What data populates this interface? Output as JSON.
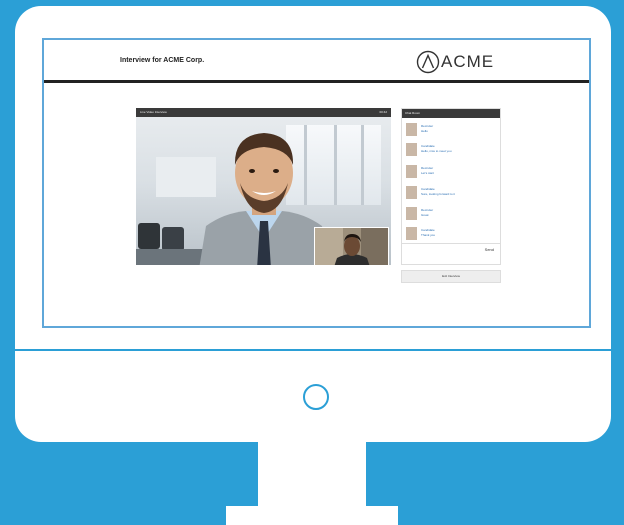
{
  "app": {
    "title": "Interview for ACME Corp.",
    "logo_text": "ACME"
  },
  "video": {
    "header_left": "Live Video Interview",
    "header_right": "00:42",
    "participants": [
      "candidate",
      "interviewer"
    ]
  },
  "chat": {
    "header": "Chat Room",
    "messages": [
      {
        "name": "Recruiter",
        "text": "Hello"
      },
      {
        "name": "Candidate",
        "text": "Hello, nice to meet you"
      },
      {
        "name": "Recruiter",
        "text": "Let's start"
      },
      {
        "name": "Candidate",
        "text": "Sure, looking forward to it"
      },
      {
        "name": "Recruiter",
        "text": "Great"
      },
      {
        "name": "Candidate",
        "text": "Thank you"
      }
    ],
    "send_label": "Send"
  },
  "actions": {
    "exit_label": "Exit Interview"
  },
  "colors": {
    "background": "#2b9fd6",
    "accent": "#5fa7d9",
    "header_bar": "#3a3a3a",
    "link": "#2b6fb3"
  }
}
